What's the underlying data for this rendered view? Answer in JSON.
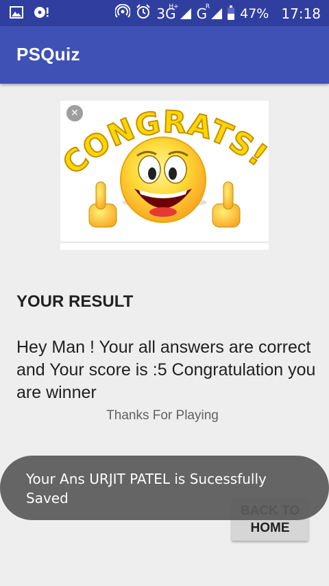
{
  "status_bar": {
    "network": "3G",
    "network_sup": "H+",
    "network2": "G",
    "network2_sup": "R",
    "battery": "47%",
    "time": "17:18"
  },
  "app_bar": {
    "title": "PSQuiz"
  },
  "congrats_image": {
    "text": "CONGRATS!",
    "close": "✕"
  },
  "result": {
    "heading": "YOUR RESULT",
    "message": "Hey Man ! Your all answers are correct and Your score is :5 Congratulation you are winner",
    "thanks": "Thanks For Playing"
  },
  "back_button": {
    "label": "BACK TO HOME"
  },
  "toast": {
    "message": "Your Ans URJIT PATEL is Sucessfully Saved"
  },
  "colors": {
    "status_bar": "#303f9f",
    "app_bar": "#3f51b5",
    "background": "#eeeeee"
  }
}
